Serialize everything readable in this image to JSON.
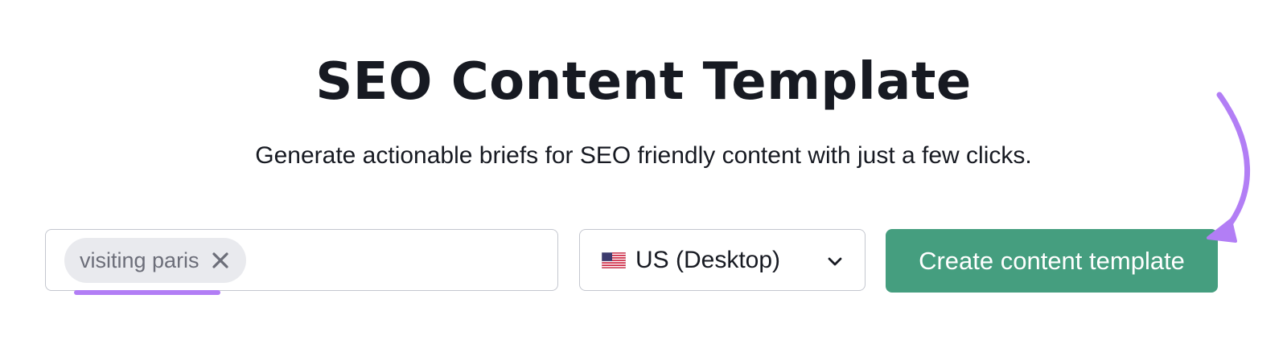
{
  "header": {
    "title": "SEO Content Template",
    "subtitle": "Generate actionable briefs for SEO friendly content with just a few clicks."
  },
  "keyword_input": {
    "chip_label": "visiting paris",
    "chip_close_icon": "close-icon"
  },
  "database_select": {
    "flag_icon": "us-flag-icon",
    "selected": "US (Desktop)",
    "chevron_icon": "chevron-down-icon"
  },
  "create_button": {
    "label": "Create content template",
    "color": "#459e7f"
  },
  "annotations": {
    "accent_color": "#b27ef5",
    "arrow_icon": "curved-arrow-icon"
  },
  "colors": {
    "text": "#171a22",
    "chip_bg": "#e9eaee",
    "chip_text": "#6c6e79",
    "border": "#c4c7cf"
  }
}
